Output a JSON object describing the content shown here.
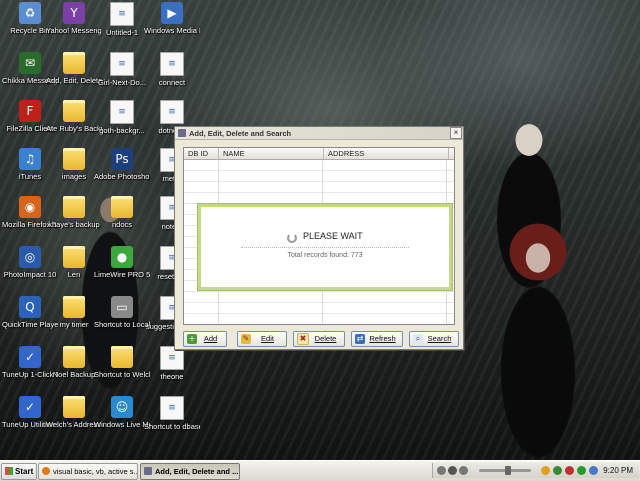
{
  "desktop_icons": [
    {
      "label": "Recycle Bin",
      "icon": "recycle-bin-icon"
    },
    {
      "label": "Yahoo! Messenger",
      "icon": "yahoo-messenger-icon"
    },
    {
      "label": "Untitled-1",
      "icon": "document-icon"
    },
    {
      "label": "Windows Media Player",
      "icon": "media-player-icon"
    },
    {
      "label": "Chikka Messenger v4",
      "icon": "chikka-icon"
    },
    {
      "label": "Add, Edit, Delete, Sea...",
      "icon": "folder-icon"
    },
    {
      "label": "Girl-Next-Do...",
      "icon": "document-icon"
    },
    {
      "label": "connect",
      "icon": "document-icon"
    },
    {
      "label": "FileZilla Client",
      "icon": "filezilla-icon"
    },
    {
      "label": "Ate Ruby's Backup",
      "icon": "folder-icon"
    },
    {
      "label": "goth-backgr...",
      "icon": "document-icon"
    },
    {
      "label": "dotnet...",
      "icon": "document-icon"
    },
    {
      "label": "iTunes",
      "icon": "itunes-icon"
    },
    {
      "label": "images",
      "icon": "folder-icon"
    },
    {
      "label": "Adobe Photoshop CS...",
      "icon": "photoshop-icon"
    },
    {
      "label": "met...",
      "icon": "document-icon"
    },
    {
      "label": "Mozilla Firefox 3.5 Beta 4",
      "icon": "firefox-icon"
    },
    {
      "label": "khaye's backup",
      "icon": "folder-icon"
    },
    {
      "label": "ndocs",
      "icon": "folder-icon"
    },
    {
      "label": "note...",
      "icon": "document-icon"
    },
    {
      "label": "PhotoImpact 10",
      "icon": "photoimpact-icon"
    },
    {
      "label": "Len",
      "icon": "folder-icon"
    },
    {
      "label": "LimeWire PRO 5.1.2",
      "icon": "limewire-icon"
    },
    {
      "label": "reset p...",
      "icon": "document-icon"
    },
    {
      "label": "QuickTime Player",
      "icon": "quicktime-icon"
    },
    {
      "label": "my timer",
      "icon": "folder-icon"
    },
    {
      "label": "Shortcut to Local Disk (D)",
      "icon": "disk-shortcut-icon"
    },
    {
      "label": "suggestio... site",
      "icon": "document-icon"
    },
    {
      "label": "TuneUp 1-Click Maintenance",
      "icon": "tuneup-icon"
    },
    {
      "label": "Noel Backup",
      "icon": "folder-icon"
    },
    {
      "label": "Shortcut to Welch_Timer",
      "icon": "folder-icon"
    },
    {
      "label": "theone",
      "icon": "document-icon"
    },
    {
      "label": "TuneUp Utilities 2009",
      "icon": "tuneup-icon"
    },
    {
      "label": "Welch's Address B...",
      "icon": "folder-icon"
    },
    {
      "label": "Windows Live Messenger",
      "icon": "live-messenger-icon"
    },
    {
      "label": "Shortcut to dbase",
      "icon": "document-icon"
    }
  ],
  "window": {
    "title": "Add, Edit, Delete and Search",
    "close_glyph": "×",
    "columns": [
      "DB ID",
      "NAME",
      "ADDRESS"
    ],
    "wait_message": "PLEASE WAIT",
    "records_text": "Total records found:  773",
    "buttons": {
      "add": "Add",
      "edit": "Edit",
      "delete": "Delete",
      "refresh": "Refresh",
      "search": "Search"
    }
  },
  "taskbar": {
    "start_label": "Start",
    "tasks": [
      {
        "label": "visual basic, vb, active s...",
        "active": false
      },
      {
        "label": "Add, Edit, Delete and ...",
        "active": true
      }
    ],
    "clock": "9:20 PM"
  },
  "colors": {
    "wait_border": "#c4d889",
    "button_border": "#6f8fb8",
    "folder": "#e9b72c"
  }
}
